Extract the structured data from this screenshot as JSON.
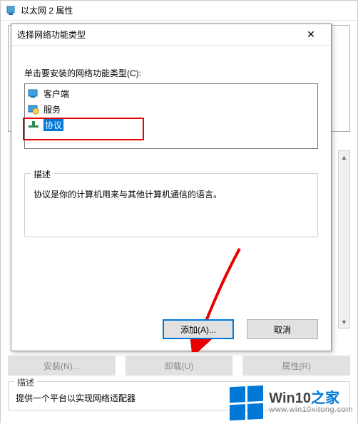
{
  "outer": {
    "title": "以太网 2 属性",
    "buttons": {
      "install": "安装(N)...",
      "uninstall": "卸载(U)",
      "props": "属性(R)"
    },
    "desc_legend": "描述",
    "desc_text": "提供一个平台以实现网络适配器"
  },
  "dialog": {
    "title": "选择网络功能类型",
    "close": "✕",
    "instruction": "单击要安装的网络功能类型(C):",
    "items": [
      {
        "label": "客户端",
        "icon": "client",
        "selected": false
      },
      {
        "label": "服务",
        "icon": "service",
        "selected": false
      },
      {
        "label": "协议",
        "icon": "protocol",
        "selected": true
      }
    ],
    "desc_legend": "描述",
    "desc_text": "协议是你的计算机用来与其他计算机通信的语言。",
    "add": "添加(A)...",
    "cancel": "取消"
  },
  "watermark": {
    "brand_main": "Win10",
    "brand_suffix": "之家",
    "url": "www.win10xitong.com"
  },
  "scroll": {
    "up": "▲",
    "down": "▼"
  }
}
